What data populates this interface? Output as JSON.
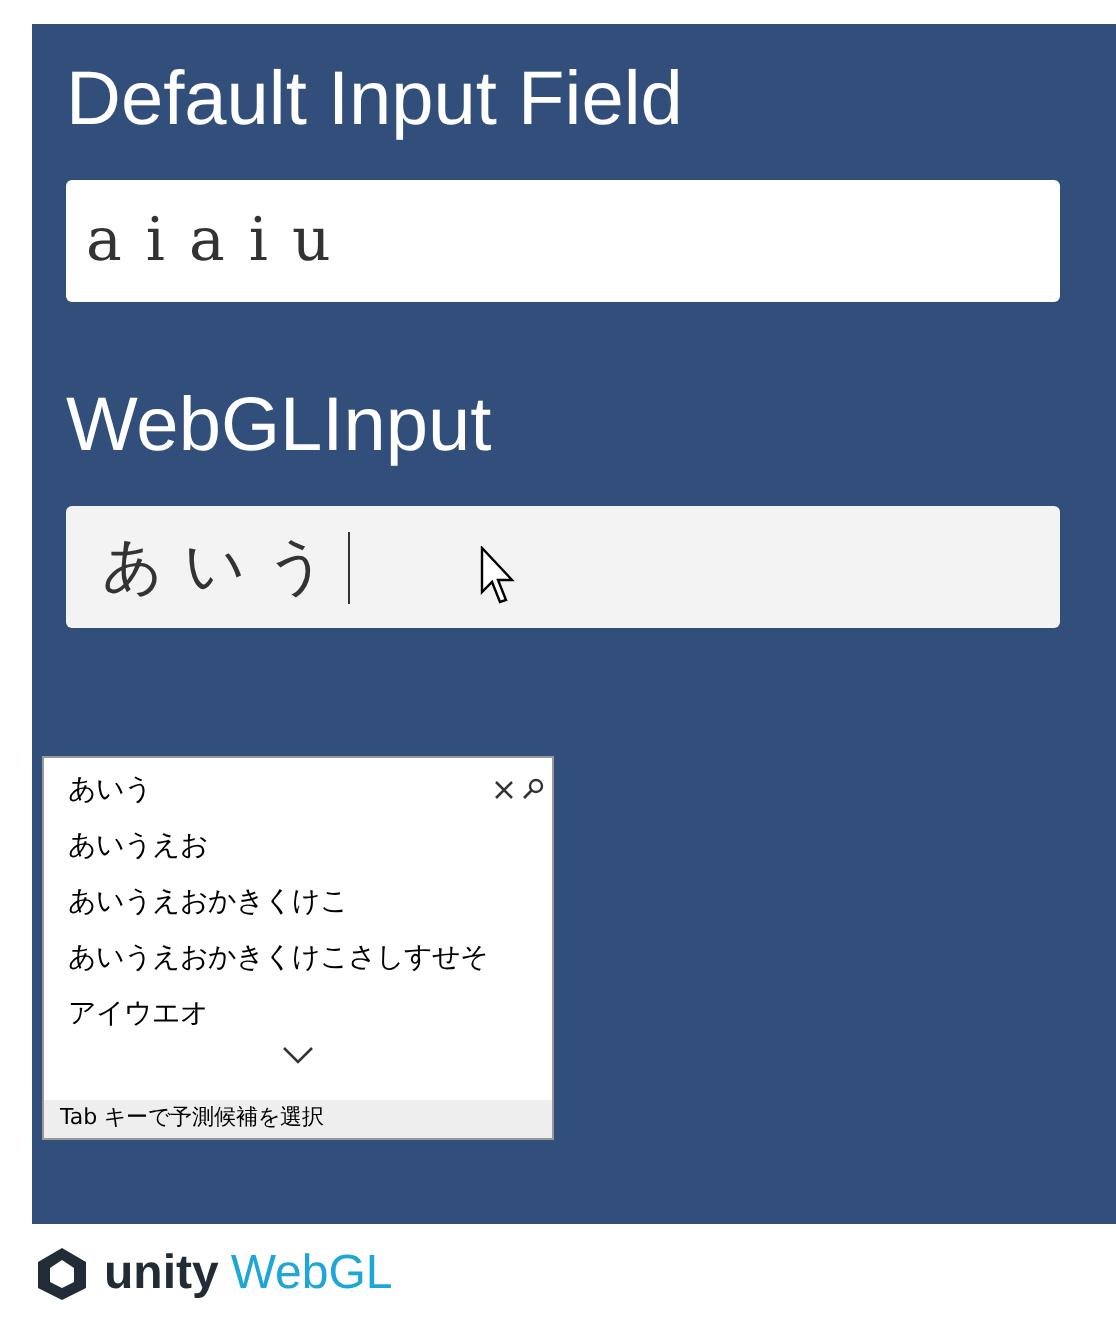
{
  "sections": [
    {
      "title": "Default Input Field",
      "value": "aiaiu",
      "kind": "default"
    },
    {
      "title": "WebGLInput",
      "value": "あいう",
      "kind": "webgl"
    }
  ],
  "ime_popup": {
    "candidates": [
      "あいう",
      "あいうえお",
      "あいうえおかきくけこ",
      "あいうえおかきくけこさしすせそ",
      "アイウエオ"
    ],
    "hint": "Tab キーで予測候補を選択"
  },
  "footer": {
    "brand": "unity",
    "product": "WebGL"
  }
}
